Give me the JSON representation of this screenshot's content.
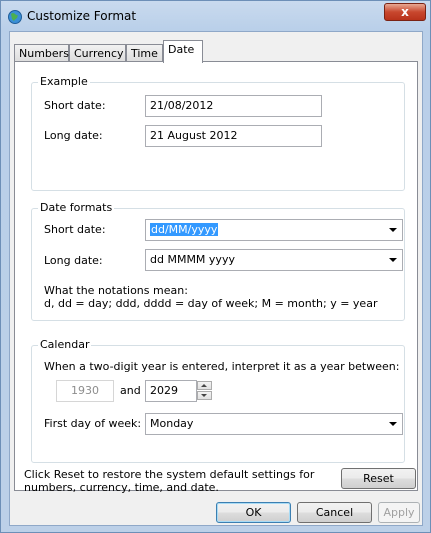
{
  "window": {
    "title": "Customize Format",
    "close_label": "x"
  },
  "tabs": [
    {
      "label": "Numbers"
    },
    {
      "label": "Currency"
    },
    {
      "label": "Time"
    },
    {
      "label": "Date"
    }
  ],
  "example": {
    "title": "Example",
    "short_label": "Short date:",
    "short_value": "21/08/2012",
    "long_label": "Long date:",
    "long_value": "21 August 2012"
  },
  "formats": {
    "title": "Date formats",
    "short_label": "Short date:",
    "short_value": "dd/MM/yyyy",
    "long_label": "Long date:",
    "long_value": "dd MMMM yyyy",
    "notation_line1": "What the notations mean:",
    "notation_line2": "d, dd = day;  ddd, dddd = day of week;  M = month;  y = year"
  },
  "calendar": {
    "title": "Calendar",
    "two_digit_text": "When a two-digit year is entered, interpret it as a year between:",
    "year_from": "1930",
    "and_label": "and",
    "year_to": "2029",
    "first_day_label": "First day of week:",
    "first_day_value": "Monday"
  },
  "reset": {
    "text_line1": "Click Reset to restore the system default settings for",
    "text_line2": "numbers, currency, time, and date.",
    "button": "Reset"
  },
  "footer": {
    "ok": "OK",
    "cancel": "Cancel",
    "apply": "Apply"
  }
}
